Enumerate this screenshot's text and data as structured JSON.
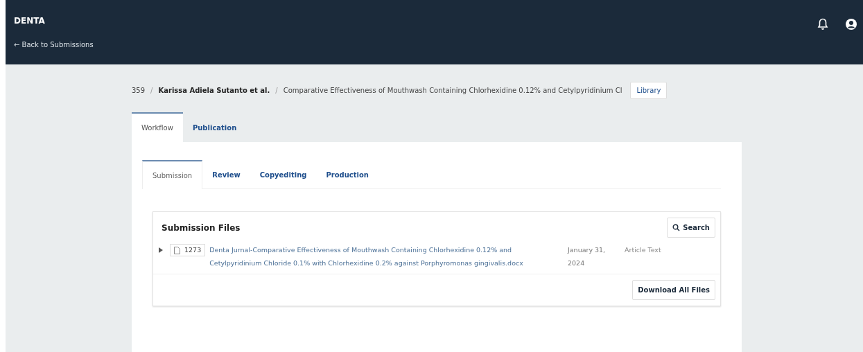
{
  "header": {
    "title": "DENTA",
    "back_link": "← Back to Submissions"
  },
  "breadcrumb": {
    "id": "359",
    "authors": "Karissa Adiela Sutanto et al.",
    "title": "Comparative Effectiveness of Mouthwash Containing Chlorhexidine 0.12% and Cetylpyridinium Cl",
    "library_button": "Library",
    "separators": [
      "/",
      "/"
    ]
  },
  "tabs": [
    {
      "label": "Workflow",
      "selected": true
    },
    {
      "label": "Publication",
      "selected": false
    }
  ],
  "stage_tabs": [
    {
      "label": "Submission",
      "selected": true
    },
    {
      "label": "Review",
      "selected": false
    },
    {
      "label": "Copyediting",
      "selected": false
    },
    {
      "label": "Production",
      "selected": false
    }
  ],
  "submission_files": {
    "title": "Submission Files",
    "search_button": "Search",
    "files": [
      {
        "id": "1273",
        "name": "Denta Jurnal-Comparative Effectiveness of Mouthwash Containing Chlorhexidine 0.12% and Cetylpyridinium Chloride 0.1% with Chlorhexidine 0.2% against Porphyromonas gingivalis.docx",
        "date": "January 31, 2024",
        "type": "Article Text"
      }
    ],
    "download_button": "Download All Files"
  }
}
